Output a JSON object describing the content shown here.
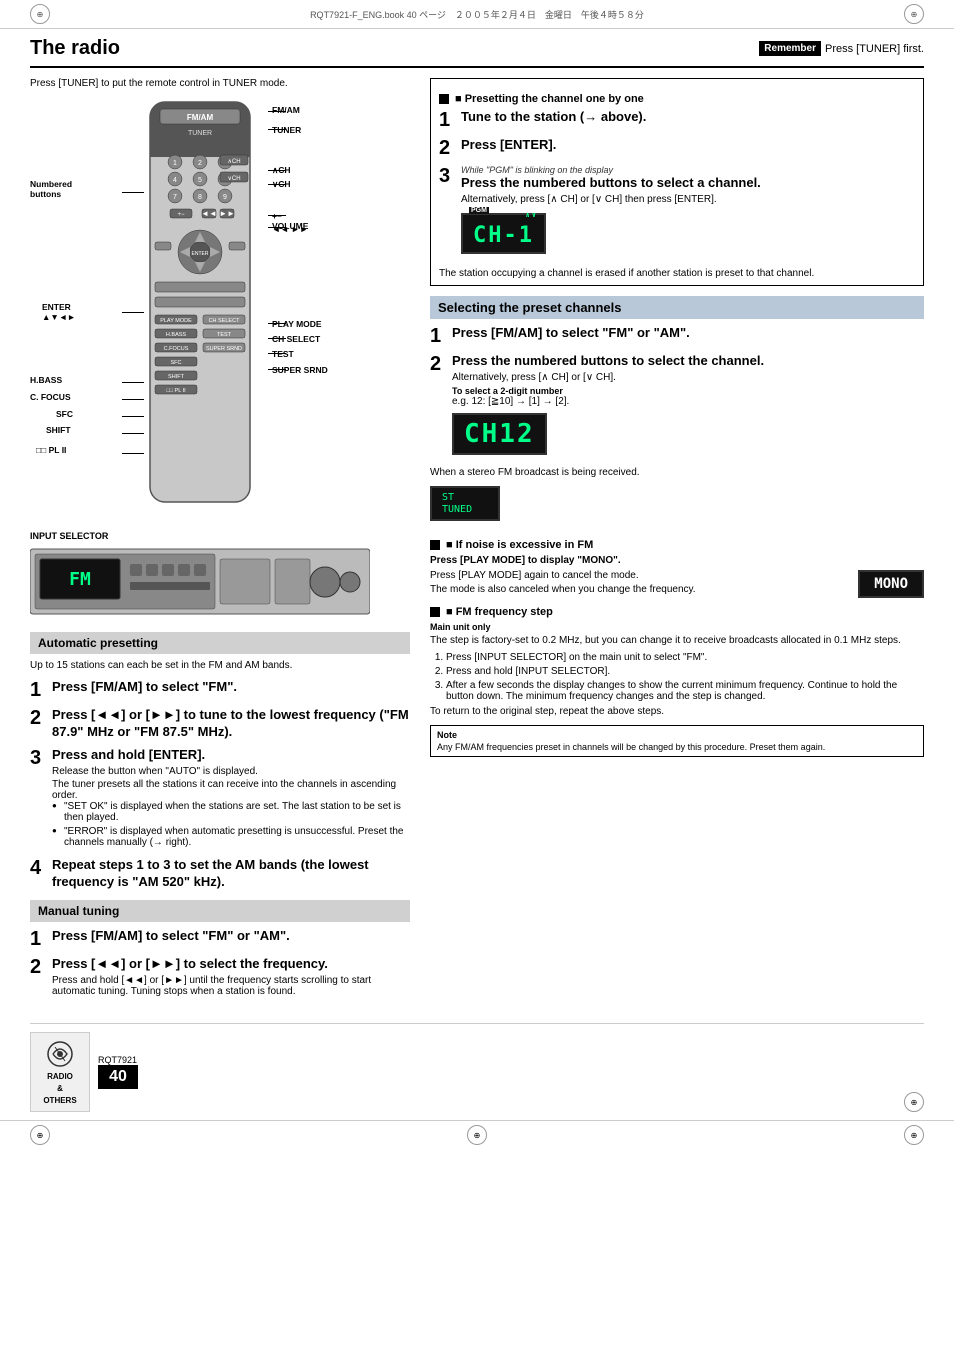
{
  "top_marks": {
    "file_info": "RQT7921-F_ENG.book  40 ページ　２００５年２月４日　金曜日　午後４時５８分"
  },
  "header": {
    "title": "The radio",
    "remember_label": "Remember",
    "remember_text": "Press [TUNER] first."
  },
  "left_column": {
    "intro": "Press [TUNER] to put the remote control in TUNER mode.",
    "labels": {
      "fm_am": "FM/AM",
      "tuner": "TUNER",
      "numbered_buttons": "Numbered\nbuttons",
      "ch_up": "∧CH",
      "ch_down": "∨CH",
      "volume": "+−\nVOLUME",
      "enter": "ENTER\n▲▼◄►",
      "h_bass": "H.BASS",
      "c_focus": "C. FOCUS",
      "sfc": "SFC",
      "shift": "SHIFT",
      "pl_ii": "□□ PL II",
      "play_mode": "PLAY MODE",
      "ch_select": "CH SELECT",
      "test": "TEST",
      "super_srnd": "SUPER SRND",
      "input_selector": "INPUT SELECTOR"
    },
    "auto_presetting": {
      "section_title": "Automatic presetting",
      "intro": "Up to 15 stations can each be set in the FM and AM bands.",
      "steps": [
        {
          "num": "1",
          "main": "Press [FM/AM] to select \"FM\"."
        },
        {
          "num": "2",
          "main": "Press [◄◄] or [►►] to tune to the lowest frequency (\"FM 87.9\" MHz or \"FM 87.5\" MHz)."
        },
        {
          "num": "3",
          "main": "Press and hold [ENTER].",
          "sub1": "Release the button when \"AUTO\" is displayed.",
          "sub2": "The tuner presets all the stations it can receive into the channels in ascending order.",
          "bullets": [
            "\"SET OK\" is displayed when the stations are set. The last station to be set is then played.",
            "\"ERROR\" is displayed when automatic presetting is unsuccessful. Preset the channels manually (→ right)."
          ]
        },
        {
          "num": "4",
          "main": "Repeat steps 1 to 3 to set the AM bands (the lowest frequency is \"AM 520\" kHz)."
        }
      ]
    },
    "manual_tuning": {
      "section_title": "Manual tuning",
      "steps": [
        {
          "num": "1",
          "main": "Press [FM/AM] to select \"FM\" or \"AM\"."
        },
        {
          "num": "2",
          "main": "Press [◄◄] or [►►] to select the frequency.",
          "sub": "Press and hold [◄◄] or [►►] until the frequency starts scrolling to start automatic tuning. Tuning stops when a station is found."
        }
      ]
    }
  },
  "right_column": {
    "presetting_one_by_one": {
      "section_title": "■ Presetting the channel one by one",
      "steps": [
        {
          "num": "1",
          "main": "Tune to the station (→ above)."
        },
        {
          "num": "2",
          "main": "Press [ENTER]."
        },
        {
          "num": "3",
          "sub_label": "While \"PGM\" is blinking on the display",
          "main": "Press the numbered buttons to select a channel.",
          "sub": "Alternatively, press [∧ CH] or [∨ CH] then press [ENTER].",
          "display": "CH-1",
          "pgm_label": "PGM"
        }
      ],
      "note": "The station occupying a channel is erased if another station is preset to that channel."
    },
    "selecting_preset": {
      "section_title": "Selecting the preset channels",
      "steps": [
        {
          "num": "1",
          "main": "Press [FM/AM] to select \"FM\" or \"AM\"."
        },
        {
          "num": "2",
          "main": "Press the numbered buttons to select the channel.",
          "sub": "Alternatively, press [∧ CH] or [∨ CH].",
          "sub2_label": "To select a 2-digit number",
          "sub2": "e.g. 12: [≧10] → [1] → [2].",
          "display": "CH12"
        }
      ],
      "stereo_note": "When a stereo FM broadcast is being received.",
      "stereo_display_lines": [
        "ST",
        "TUNED"
      ]
    },
    "if_noise": {
      "heading": "■ If noise is excessive in FM",
      "sub_heading": "Press [PLAY MODE] to display \"MONO\".",
      "note1": "Press [PLAY MODE] again to cancel the mode.",
      "note2": "The mode is also canceled when you change the frequency.",
      "mono_display": "MONO"
    },
    "fm_frequency_step": {
      "heading": "■ FM frequency step",
      "sub_heading": "Main unit only",
      "text1": "The step is factory-set to 0.2 MHz, but you can change it to receive broadcasts allocated in 0.1 MHz steps.",
      "steps": [
        "Press [INPUT SELECTOR] on the main unit to select \"FM\".",
        "Press and hold [INPUT SELECTOR].",
        "After a few seconds the display changes to show the current minimum frequency. Continue to hold the button down. The minimum frequency changes and the step is changed.",
        "To return to the original step, repeat the above steps."
      ]
    },
    "note_section": {
      "title": "Note",
      "text": "Any FM/AM frequencies preset in channels will be changed by this procedure. Preset them again."
    }
  },
  "footer": {
    "model": "RQT7921",
    "page_number": "40",
    "sidebar_icon_lines": [
      "RADIO",
      "&",
      "OTHERS"
    ]
  }
}
